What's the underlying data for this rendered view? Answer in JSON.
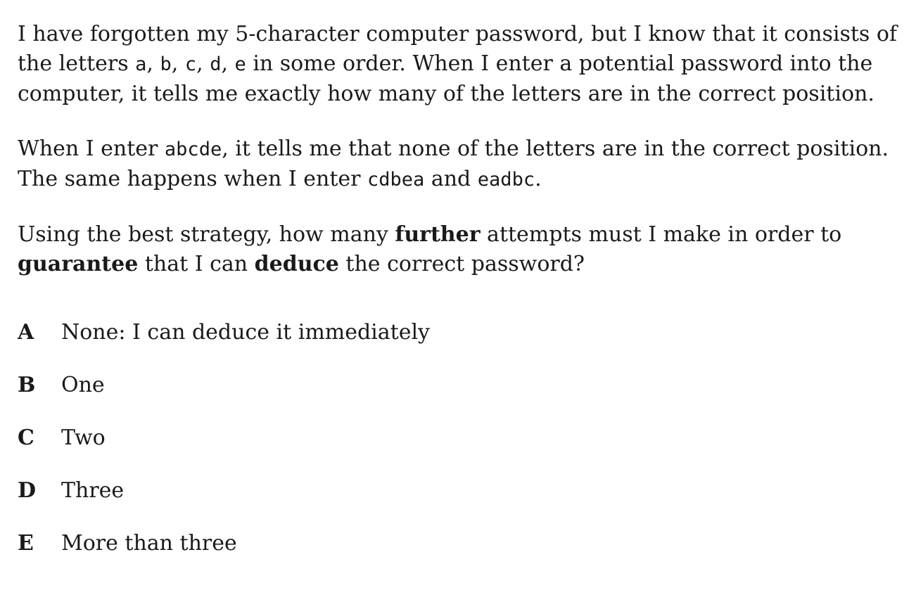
{
  "question": {
    "p1": {
      "l1": "I have forgotten my 5-character computer password, but I know that it consists of",
      "l2_a": "the letters ",
      "l2_codes": [
        "a",
        "b",
        "c",
        "d",
        "e"
      ],
      "l2_sep": ", ",
      "l2_b": " in some order.  When I enter a potential password into the",
      "l3": "computer, it tells me exactly how many of the letters are in the correct position."
    },
    "p2": {
      "l1_a": "When I enter ",
      "code1": "abcde",
      "l1_b": ", it tells me that none of the letters are in the correct position.",
      "l2_a": "The same happens when I enter ",
      "code2": "cdbea",
      "l2_b": " and ",
      "code3": "eadbc",
      "l2_c": "."
    },
    "p3": {
      "l1_a": "Using the best strategy, how many ",
      "bold1": "further",
      "l1_b": " attempts must I make in order to",
      "bold2": "guarantee",
      "l2_a": " that I can ",
      "bold3": "deduce",
      "l2_b": " the correct password?"
    }
  },
  "options": [
    {
      "letter": "A",
      "text": "None: I can deduce it immediately"
    },
    {
      "letter": "B",
      "text": "One"
    },
    {
      "letter": "C",
      "text": "Two"
    },
    {
      "letter": "D",
      "text": "Three"
    },
    {
      "letter": "E",
      "text": "More than three"
    }
  ]
}
